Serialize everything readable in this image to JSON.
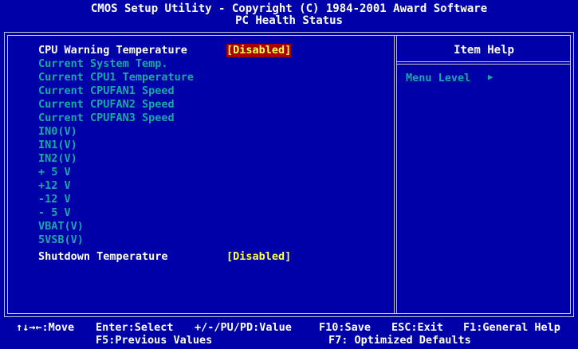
{
  "header": {
    "title": "CMOS Setup Utility - Copyright (C) 1984-2001 Award Software",
    "subtitle": "PC Health Status"
  },
  "items": [
    {
      "label": "CPU Warning Temperature",
      "value": "[Disabled]",
      "editable": true,
      "selected": true
    },
    {
      "label": "Current System Temp.",
      "editable": false
    },
    {
      "label": "Current CPU1 Temperature",
      "editable": false
    },
    {
      "label": "Current CPUFAN1 Speed",
      "editable": false
    },
    {
      "label": "Current CPUFAN2 Speed",
      "editable": false
    },
    {
      "label": "Current CPUFAN3 Speed",
      "editable": false
    },
    {
      "label": "IN0(V)",
      "editable": false
    },
    {
      "label": "IN1(V)",
      "editable": false
    },
    {
      "label": "IN2(V)",
      "editable": false
    },
    {
      "label": "+ 5 V",
      "editable": false
    },
    {
      "label": "+12 V",
      "editable": false
    },
    {
      "label": "-12 V",
      "editable": false
    },
    {
      "label": "- 5 V",
      "editable": false
    },
    {
      "label": "VBAT(V)",
      "editable": false
    },
    {
      "label": "5VSB(V)",
      "editable": false
    },
    {
      "label": "Shutdown Temperature",
      "value": "[Disabled]",
      "editable": true,
      "selected": false
    }
  ],
  "help": {
    "title": "Item Help",
    "menu_level": "Menu Level",
    "menu_level_icon": "triangle-right-icon"
  },
  "footer": {
    "nav": "↑↓→←:Move",
    "enter": "Enter:Select",
    "pu_pd": "+/-/PU/PD:Value",
    "f10": "F10:Save",
    "esc": "ESC:Exit",
    "f1": "F1:General Help",
    "f5": "F5:Previous Values",
    "f7": "F7: Optimized Defaults"
  },
  "colors": {
    "background": "#0000a8",
    "item_label": "#ffffff",
    "info_label": "#18a8a8",
    "value": "#ffff54",
    "selected_bg": "#a80000"
  }
}
